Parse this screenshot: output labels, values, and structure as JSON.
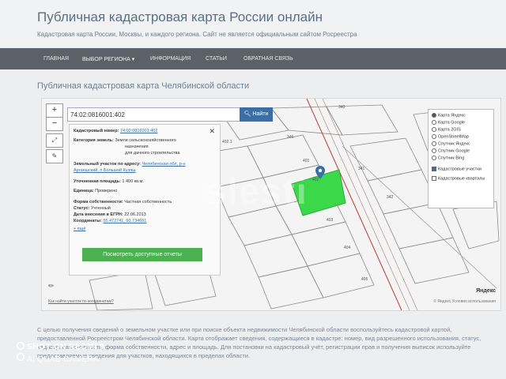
{
  "header": {
    "title": "Публичная кадастровая карта России онлайн",
    "subtitle": "Кадастровая карта России, Москвы, и каждого региона. Сайт не является официальным сайтом Росреестра"
  },
  "nav": {
    "items": [
      "ГЛАВНАЯ",
      "ВЫБОР РЕГИОНА",
      "ИНФОРМАЦИЯ",
      "СТАТЬИ",
      "ОБРАТНАЯ СВЯЗЬ"
    ]
  },
  "page": {
    "heading": "Публичная кадастровая карта Челябинской области"
  },
  "map": {
    "search": {
      "value": "74:02:0816001:402",
      "button": "Найти"
    },
    "zoom_in": "+",
    "zoom_out": "−",
    "info": {
      "cad_number_label": "Кадастровый номер:",
      "cad_number_value": "74:02:0816001:402",
      "category_label": "Категория земель:",
      "category_value_1": "Земли сельскохозяйственного",
      "category_value_2": "назначения",
      "use_value": "для дачного строительства",
      "address_label": "Земельный участок по адресу:",
      "address_value_1": "Челябинская обл, р-н",
      "address_value_2": "Аргаяшский, п Большой Кузяш",
      "area_label": "Уточненная площадь:",
      "area_value": "1 400 кв.м.",
      "unit_label": "Единица:",
      "unit_value": "Проверено",
      "ownership_label": "Форма собственности:",
      "ownership_value": "Частная собственность",
      "status_label": "Статус:",
      "status_value": "Учтенный",
      "date_label": "Дата внесения в ЕГРН:",
      "date_value": "22.06.2013",
      "coords_label": "Координаты:",
      "coords_value": "55.472741, 60.734691",
      "more_link": "+ ещё",
      "cta_button": "Посмотреть доступные отчеты"
    },
    "layers": [
      {
        "label": "Карта Яндекс",
        "type": "radio",
        "checked": true
      },
      {
        "label": "Карта Google",
        "type": "radio",
        "checked": false
      },
      {
        "label": "Карта 2GIS",
        "type": "radio",
        "checked": false
      },
      {
        "label": "OpenStreetMap",
        "type": "radio",
        "checked": false
      },
      {
        "label": "Спутник Яндекс",
        "type": "radio",
        "checked": false
      },
      {
        "label": "Спутник Google",
        "type": "radio",
        "checked": false
      },
      {
        "label": "Спутник Bing",
        "type": "radio",
        "checked": false
      },
      {
        "label": "Кадастровые участки",
        "type": "check",
        "checked": true
      },
      {
        "label": "Кадастровые кварталы",
        "type": "check",
        "checked": false
      }
    ],
    "footer_link": "Как найти участок по координатам?",
    "logo": "Яндекс",
    "attribution": "© Яндекс Условия использования",
    "parcel_labels": [
      "340",
      "346",
      "403",
      "402",
      "401",
      "404",
      "405",
      "402.1",
      "341",
      "342"
    ]
  },
  "description": "С целью получения сведений о земельном участке или при поиске объекта недвижимости Челябинской области воспользуйтесь кадастровой картой, предоставленной Росреестром Челябинской области. Карта отображает сведения, содержащиеся в кадастре: номер, вид разрешенного использования, статус, кадастровая стоимость, форма собственности, адрес и площадь. Для постановки на кадастровый учёт, регистрации прав и получения выписок используйте предоставляемые сведения для участков, находящихся в пределах области.",
  "camera": {
    "line1": "SHOT ON REDMI 9",
    "line2": "AI QUAD CAMERA"
  },
  "watermark": "slesti",
  "colors": {
    "nav_bg": "#5c6068",
    "accent_blue": "#3a6ea6",
    "parcel_green": "#3bd94a",
    "cta_green": "#4caf50",
    "red_line": "#c0392b"
  }
}
